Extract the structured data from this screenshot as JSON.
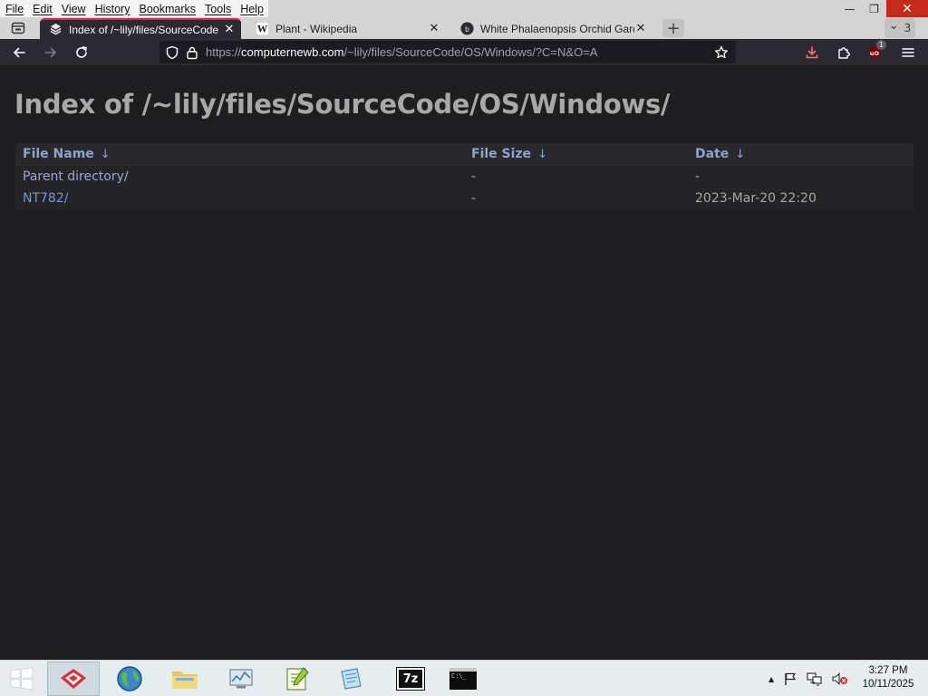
{
  "menu": {
    "items": [
      "File",
      "Edit",
      "View",
      "History",
      "Bookmarks",
      "Tools",
      "Help"
    ]
  },
  "window_controls": {
    "minimize": "—",
    "restore": "❐",
    "close": "✕"
  },
  "tabs": [
    {
      "title": "Index of /~lily/files/SourceCode",
      "icon": "directory-favicon",
      "active": true
    },
    {
      "title": "Plant - Wikipedia",
      "icon": "wikipedia-favicon",
      "active": false
    },
    {
      "title": "White Phalaenopsis Orchid Garc",
      "icon": "site-favicon",
      "active": false
    }
  ],
  "tab_close": "✕",
  "new_tab": "+",
  "tab_count": "3",
  "tab_count_chevron": "⌄",
  "urlbar": {
    "scheme": "https://",
    "host": "computernewb.com",
    "path": "/~lily/files/SourceCode/OS/Windows/?C=N&O=A"
  },
  "extension_badge": "1",
  "page": {
    "title": "Index of /~lily/files/SourceCode/OS/Windows/",
    "columns": [
      {
        "label": "File Name",
        "arrow": "↓"
      },
      {
        "label": "File Size",
        "arrow": "↓"
      },
      {
        "label": "Date",
        "arrow": "↓"
      }
    ],
    "rows": [
      {
        "name": "Parent directory/",
        "size": "-",
        "date": "-"
      },
      {
        "name": "NT782/",
        "size": "-",
        "date": "2023-Mar-20 22:20"
      }
    ]
  },
  "taskbar": {
    "clock_time": "3:27 PM",
    "clock_date": "10/11/2025",
    "tray_arrow": "▲",
    "app_7zip_label": "7z",
    "app_cmd_label": "C:\\_"
  },
  "colors": {
    "accent_tab": "#e0245e",
    "header_link": "#8ea3d4",
    "close_button": "#c42b1c"
  }
}
